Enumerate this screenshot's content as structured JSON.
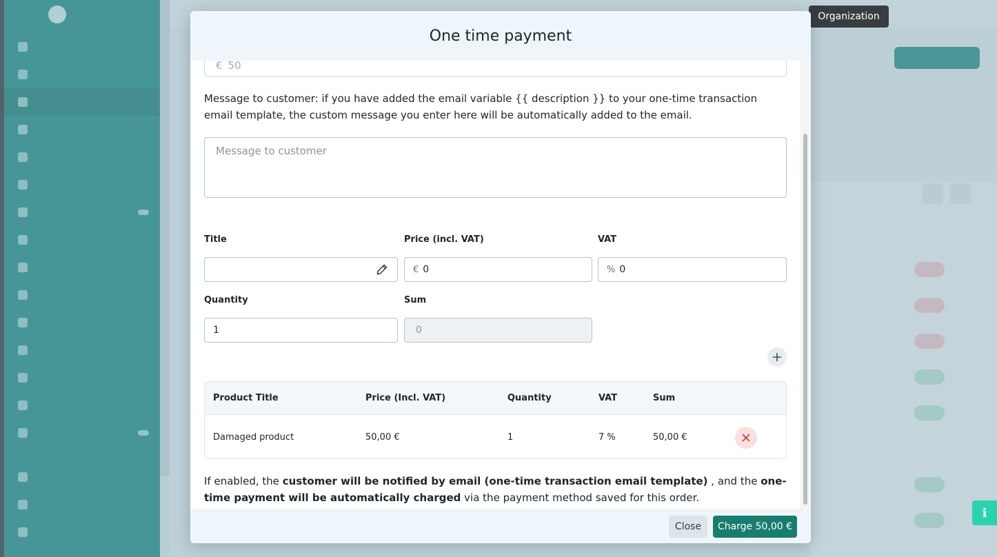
{
  "tooltip": {
    "label": "Organization"
  },
  "modal": {
    "title": "One time payment",
    "amount_field": {
      "currency": "€",
      "value": "50"
    },
    "message_text": "Message to customer: if you have added the email variable {{ description }} to your one-time transaction email template, the custom message you enter here will be automatically added to the email.",
    "message_placeholder": "Message to customer",
    "form": {
      "title_label": "Title",
      "title_value": "",
      "price_label": "Price (incl. VAT)",
      "price_prefix": "€",
      "price_value": "0",
      "vat_label": "VAT",
      "vat_prefix": "%",
      "vat_value": "0",
      "quantity_label": "Quantity",
      "quantity_value": "1",
      "sum_label": "Sum",
      "sum_value": "0"
    },
    "table": {
      "headers": [
        "Product Title",
        "Price (Incl. VAT)",
        "Quantity",
        "VAT",
        "Sum"
      ],
      "rows": [
        {
          "title": "Damaged product",
          "price": "50,00 €",
          "quantity": "1",
          "vat": "7 %",
          "sum": "50,00 €"
        }
      ]
    },
    "notice": {
      "part1": "If enabled, the ",
      "bold1": "customer will be notified by email (one-time transaction email template)",
      "part2": " , and the ",
      "bold2": "one-time payment will be automatically charged",
      "part3": " via the payment method saved for this order."
    },
    "footer": {
      "close_label": "Close",
      "charge_label": "Charge 50,00 €"
    }
  },
  "colors": {
    "sidebar": "#10867c",
    "primary_button": "#177d6f",
    "modal_header": "#eef6fb",
    "danger_soft": "#fbe0e0"
  },
  "icons": [
    "pencil-icon",
    "plus-icon",
    "close-x-icon",
    "info-icon"
  ]
}
